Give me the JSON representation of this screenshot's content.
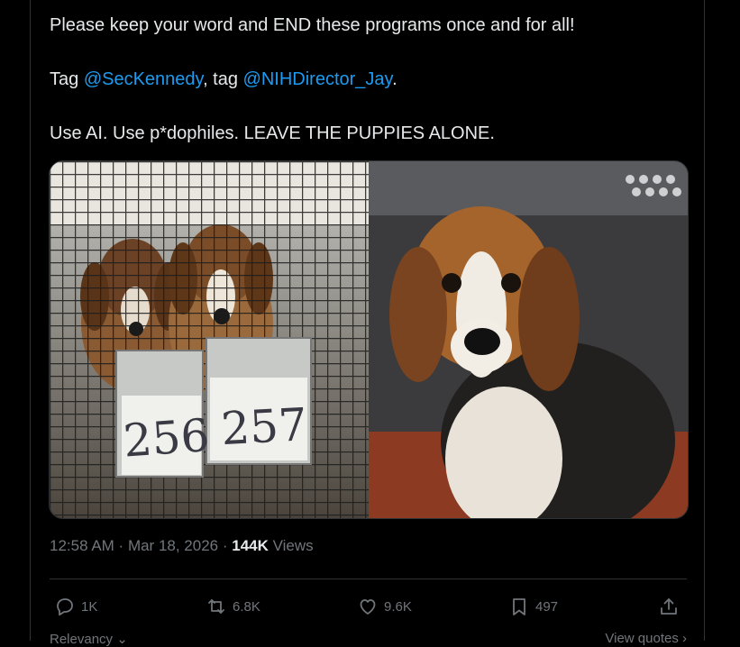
{
  "tweet": {
    "line1": "Please keep your word and END these programs once and for all!",
    "line2_prefix": "Tag ",
    "mention1": "@SecKennedy",
    "line2_mid": ", tag ",
    "mention2": "@NIHDirector_Jay",
    "line2_suffix": ".",
    "line3": "Use AI. Use p*dophiles. LEAVE THE PUPPIES ALONE."
  },
  "media": {
    "left_photo": {
      "tag_a": "256",
      "tag_b": "257"
    },
    "right_photo": {}
  },
  "meta": {
    "time": "12:58 AM",
    "sep1": " · ",
    "date": "Mar 18, 2026",
    "sep2": " · ",
    "views_count": "144K",
    "views_label": " Views"
  },
  "actions": {
    "replies": "1K",
    "reposts": "6.8K",
    "likes": "9.6K",
    "bookmarks": "497"
  },
  "bottom": {
    "relevancy": "Relevancy ⌄",
    "view_quotes": "View quotes ›"
  },
  "colors": {
    "background": "#000000",
    "text": "#e7e9ea",
    "muted": "#71767b",
    "mention": "#1d9bf0",
    "border": "#2f3336"
  }
}
